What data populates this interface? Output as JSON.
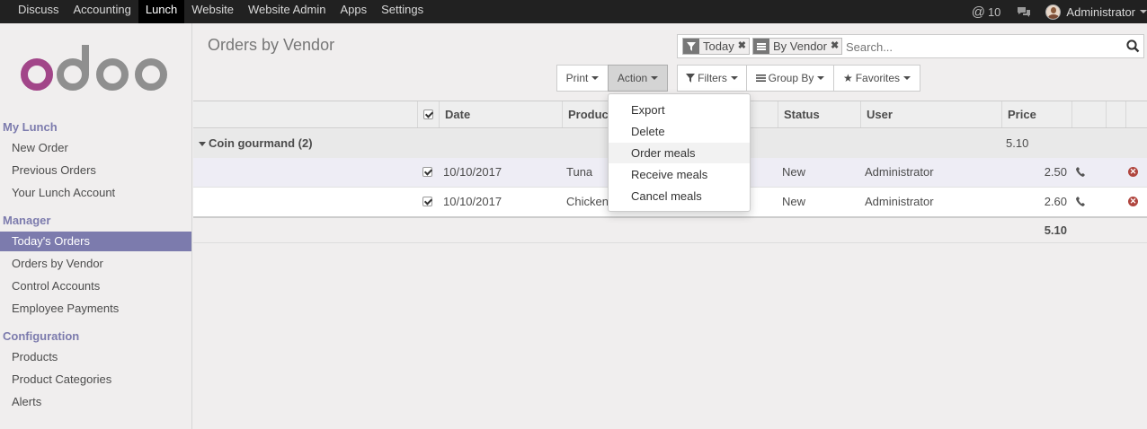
{
  "topbar": {
    "menu": [
      "Discuss",
      "Accounting",
      "Lunch",
      "Website",
      "Website Admin",
      "Apps",
      "Settings"
    ],
    "active_menu": "Lunch",
    "mentions_count": "10",
    "user_name": "Administrator"
  },
  "sidebar": {
    "sections": [
      {
        "title": "My Lunch",
        "items": [
          "New Order",
          "Previous Orders",
          "Your Lunch Account"
        ]
      },
      {
        "title": "Manager",
        "items": [
          "Today's Orders",
          "Orders by Vendor",
          "Control Accounts",
          "Employee Payments"
        ]
      },
      {
        "title": "Configuration",
        "items": [
          "Products",
          "Product Categories",
          "Alerts"
        ]
      }
    ],
    "active_item": "Today's Orders"
  },
  "page": {
    "title": "Orders by Vendor"
  },
  "search": {
    "facets": [
      "Today",
      "By Vendor"
    ],
    "placeholder": "Search..."
  },
  "toolbar": {
    "print_label": "Print",
    "action_label": "Action",
    "filters_label": "Filters",
    "groupby_label": "Group By",
    "favorites_label": "Favorites"
  },
  "action_menu": {
    "items": [
      "Export",
      "Delete",
      "Order meals",
      "Receive meals",
      "Cancel meals"
    ],
    "hovered": "Order meals"
  },
  "table": {
    "headers": {
      "date": "Date",
      "product": "Product",
      "status": "Status",
      "user": "User",
      "price": "Price"
    },
    "group": {
      "label": "Coin gourmand (2)",
      "total": "5.10"
    },
    "rows": [
      {
        "date": "10/10/2017",
        "product": "Tuna",
        "status": "New",
        "user": "Administrator",
        "price": "2.50"
      },
      {
        "date": "10/10/2017",
        "product": "Chicken",
        "status": "New",
        "user": "Administrator",
        "price": "2.60"
      }
    ],
    "footer_total": "5.10"
  },
  "colors": {
    "accent": "#7c7bad",
    "topbar": "#212121",
    "logo_o": "#a24689",
    "logo_doo": "#8f8f8f",
    "cancel_icon": "#b0463f"
  }
}
